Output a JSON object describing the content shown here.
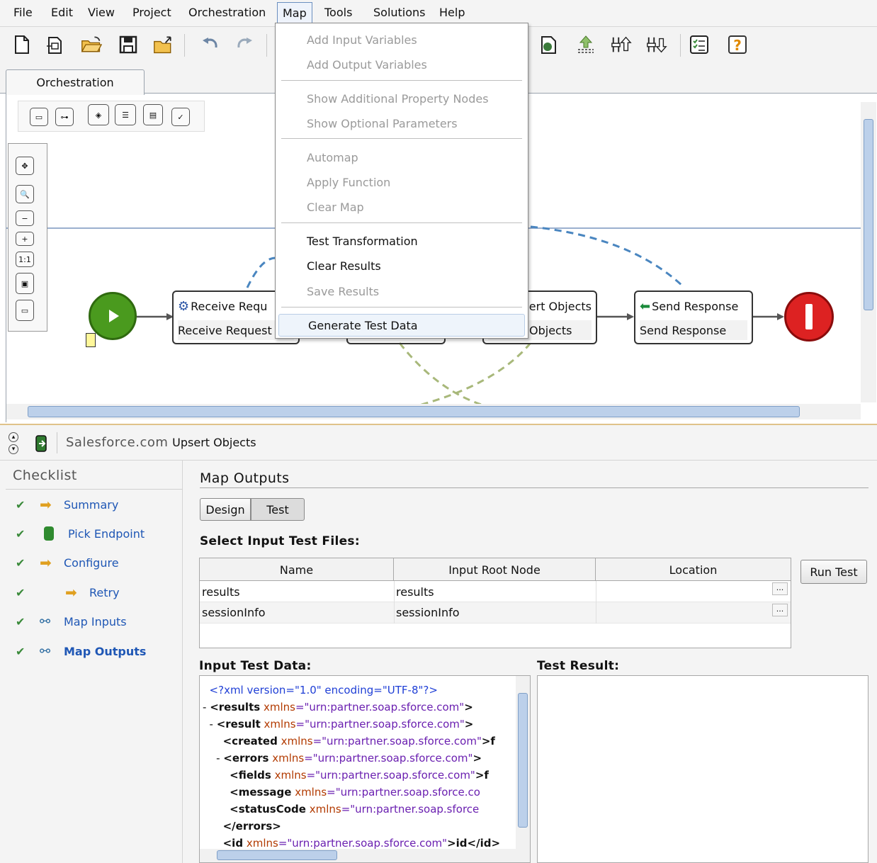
{
  "menubar": {
    "items": [
      "File",
      "Edit",
      "View",
      "Project",
      "Orchestration",
      "Map",
      "Tools",
      "Solutions",
      "Help"
    ],
    "active": "Map"
  },
  "toolbar": {
    "icons": [
      "new-file-icon",
      "new-project-icon",
      "open-folder-icon",
      "save-icon",
      "export-icon",
      "undo-icon",
      "redo-icon",
      "deploy-icon",
      "upload-icon",
      "move-up-icon",
      "move-down-icon",
      "checklist-icon",
      "help-icon"
    ]
  },
  "tabs": {
    "orchestration": "Orchestration"
  },
  "map_menu": {
    "items": [
      {
        "label": "Add Input Variables",
        "enabled": false
      },
      {
        "label": "Add Output Variables",
        "enabled": false
      },
      {
        "label": "Show Additional Property Nodes",
        "enabled": false
      },
      {
        "label": "Show Optional Parameters",
        "enabled": false
      },
      {
        "label": "Automap",
        "enabled": false
      },
      {
        "label": "Apply Function",
        "enabled": false
      },
      {
        "label": "Clear Map",
        "enabled": false
      },
      {
        "label": "Test Transformation",
        "enabled": true
      },
      {
        "label": "Clear Results",
        "enabled": true
      },
      {
        "label": "Save Results",
        "enabled": false
      },
      {
        "label": "Generate Test Data",
        "enabled": true
      }
    ],
    "highlighted": "Generate Test Data"
  },
  "canvas": {
    "receive_node": {
      "title": "Receive Requ",
      "subtitle": "Receive Request"
    },
    "upsert_node": {
      "title": "ert Objects",
      "subtitle": "Objects"
    },
    "send_node": {
      "title": "Send Response",
      "subtitle": "Send Response"
    },
    "zoom_reset": "1:1"
  },
  "panel": {
    "title_prefix": "Salesforce.com",
    "title_suffix": "Upsert Objects"
  },
  "checklist": {
    "heading": "Checklist",
    "items": [
      {
        "label": "Summary",
        "icon": "arrow-icon"
      },
      {
        "label": "Pick Endpoint",
        "icon": "database-icon"
      },
      {
        "label": "Configure",
        "icon": "arrow-icon"
      },
      {
        "label": "Retry",
        "icon": "arrow-icon"
      },
      {
        "label": "Map Inputs",
        "icon": "map-icon"
      },
      {
        "label": "Map Outputs",
        "icon": "map-icon"
      }
    ]
  },
  "map_outputs": {
    "heading": "Map Outputs",
    "design_tab": "Design",
    "test_tab": "Test",
    "select_files_label": "Select Input Test Files:",
    "columns": [
      "Name",
      "Input Root Node",
      "Location"
    ],
    "rows": [
      {
        "name": "results",
        "root": "results",
        "location": "..."
      },
      {
        "name": "sessionInfo",
        "root": "sessionInfo",
        "location": "..."
      }
    ],
    "run_test": "Run Test",
    "input_label": "Input Test Data:",
    "result_label": "Test Result:"
  },
  "xml_lines": [
    {
      "prefix": "",
      "decl": "<?xml version=\"1.0\" encoding=\"UTF-8\"?>"
    },
    {
      "prefix": "- ",
      "tag": "<results",
      "attr": "xmlns",
      "val": "=\"urn:partner.soap.sforce.com\"",
      "tail": ">"
    },
    {
      "prefix": "  - ",
      "tag": "<result",
      "attr": "xmlns",
      "val": "=\"urn:partner.soap.sforce.com\"",
      "tail": ">"
    },
    {
      "prefix": "      ",
      "tag": "<created",
      "attr": "xmlns",
      "val": "=\"urn:partner.soap.sforce.com\"",
      "tail": ">f"
    },
    {
      "prefix": "    - ",
      "tag": "<errors",
      "attr": "xmlns",
      "val": "=\"urn:partner.soap.sforce.com\"",
      "tail": ">"
    },
    {
      "prefix": "        ",
      "tag": "<fields",
      "attr": "xmlns",
      "val": "=\"urn:partner.soap.sforce.com\"",
      "tail": ">f"
    },
    {
      "prefix": "        ",
      "tag": "<message",
      "attr": "xmlns",
      "val": "=\"urn:partner.soap.sforce.co",
      "tail": ""
    },
    {
      "prefix": "        ",
      "tag": "<statusCode",
      "attr": "xmlns",
      "val": "=\"urn:partner.soap.sforce",
      "tail": ""
    },
    {
      "prefix": "      ",
      "tag": "</errors>",
      "attr": "",
      "val": "",
      "tail": ""
    },
    {
      "prefix": "      ",
      "tag": "<id",
      "attr": "xmlns",
      "val": "=\"urn:partner.soap.sforce.com\"",
      "tail": ">id</id>"
    }
  ]
}
